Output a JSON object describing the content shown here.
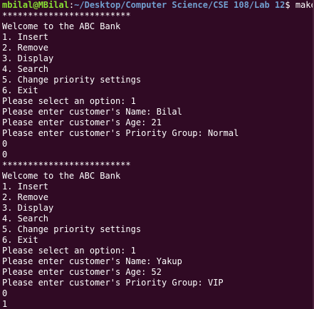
{
  "prompt": {
    "user_host": "mbilal@MBilal",
    "colon": ":",
    "path": "~/Desktop/Computer Science/CSE 108/Lab 12",
    "dollar": "$ ",
    "command": "make"
  },
  "output_lines": [
    "*************************",
    "Welcome to the ABC Bank",
    "1. Insert",
    "2. Remove",
    "3. Display",
    "4. Search",
    "5. Change priority settings",
    "6. Exit",
    "Please select an option: 1",
    "Please enter customer's Name: Bilal",
    "Please enter customer's Age: 21",
    "Please enter customer's Priority Group: Normal",
    "0",
    "0",
    "*************************",
    "Welcome to the ABC Bank",
    "1. Insert",
    "2. Remove",
    "3. Display",
    "4. Search",
    "5. Change priority settings",
    "6. Exit",
    "Please select an option: 1",
    "Please enter customer's Name: Yakup",
    "Please enter customer's Age: 52",
    "Please enter customer's Priority Group: VIP",
    "0",
    "1"
  ],
  "colors": {
    "background": "#300a24",
    "text": "#ffffff",
    "prompt_user": "#8ae234",
    "prompt_path": "#729fcf"
  }
}
